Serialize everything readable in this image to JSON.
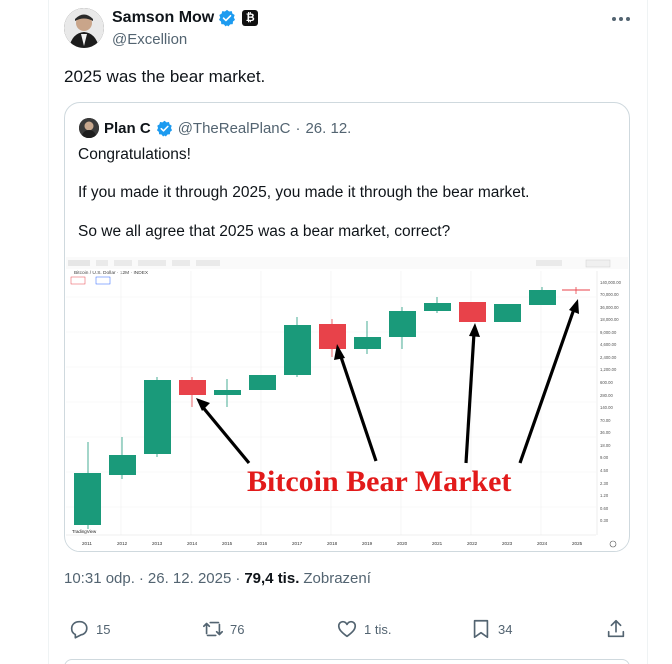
{
  "author": {
    "name": "Samson Mow",
    "handle": "@Excellion",
    "affiliate_badge": "₿"
  },
  "tweet_text": "2025 was the bear market.",
  "quote": {
    "name": "Plan C",
    "handle": "@TheRealPlanC",
    "separator": "·",
    "date": "26. 12.",
    "lines": [
      "Congratulations!",
      "If you made it through 2025, you made it through the bear market.",
      "So we all agree that 2025 was a bear market, correct?"
    ]
  },
  "chart_image": {
    "symbol_line": "Bitcoin / U.S. Dollar · 12M · INDEX",
    "overlay_text": "Bitcoin Bear Market",
    "footer_brand": "TradingView",
    "price_axis": [
      "140,000.00",
      "70,000.00",
      "36,000.00",
      "18,000.00",
      "9,000.00",
      "4,600.00",
      "2,400.00",
      "1,200.00",
      "600.00",
      "280.00",
      "140.00",
      "70.00",
      "36.00",
      "18.00",
      "9.00",
      "4.50",
      "2.30",
      "1.20",
      "0.60",
      "0.30"
    ],
    "year_axis": [
      "2011",
      "2012",
      "2013",
      "2014",
      "2015",
      "2016",
      "2017",
      "2018",
      "2019",
      "2020",
      "2021",
      "2022",
      "2023",
      "2024",
      "2025"
    ],
    "colors": {
      "up": "#1a9a7a",
      "down": "#e8424a",
      "overlay": "#e21a1a"
    }
  },
  "meta": {
    "time": "10:31 odp.",
    "sep1": "·",
    "date": "26. 12. 2025",
    "sep2": "·",
    "views": "79,4 tis.",
    "views_label": "Zobrazení"
  },
  "actions": {
    "replies": "15",
    "reposts": "76",
    "likes": "1 tis.",
    "bookmarks": "34"
  },
  "icons": [
    "verified-icon",
    "more-icon",
    "reply-icon",
    "repost-icon",
    "like-icon",
    "bookmark-icon",
    "share-icon"
  ]
}
